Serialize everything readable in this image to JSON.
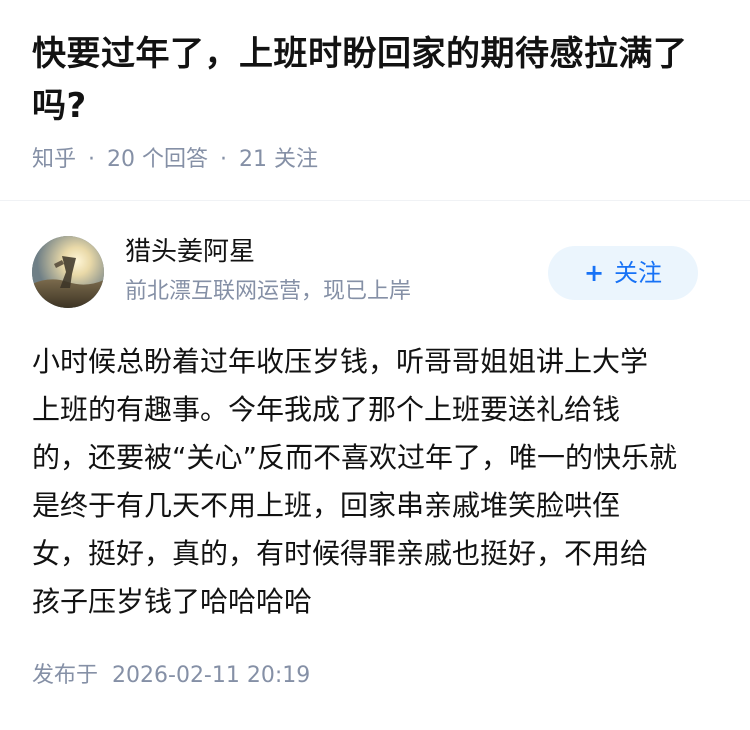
{
  "question": {
    "title": "快要过年了，上班时盼回家的期待感拉满了吗?",
    "source": "知乎",
    "separator": "·",
    "answers": "20 个回答",
    "followers": "21 关注"
  },
  "author": {
    "name": "猎头姜阿星",
    "bio": "前北漂互联网运营，现已上岸",
    "follow_plus": "+",
    "follow_label": "关注",
    "avatar_icon": "avatar-photo"
  },
  "answer": {
    "lines": [
      "小时候总盼着过年收压岁钱，听哥哥姐姐讲上大学",
      "上班的有趣事。今年我成了那个上班要送礼给钱",
      "的，还要被“关心”反而不喜欢过年了，唯一的快乐就",
      "是终于有几天不用上班，回家串亲戚堆笑脸哄侄",
      "女，挺好，真的，有时候得罪亲戚也挺好，不用给",
      "孩子压岁钱了哈哈哈哈"
    ]
  },
  "footer": {
    "published_label": "发布于",
    "published_time": "2026-02-11 20:19"
  },
  "colors": {
    "meta_gray": "#8590a6",
    "accent_blue": "#1772f6",
    "follow_bg": "#ebf5fd"
  }
}
